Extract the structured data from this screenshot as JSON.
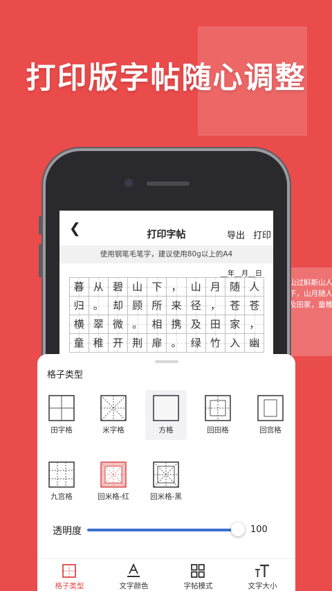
{
  "headline": "打印版字帖随心调整",
  "side_text": [
    "山过斛斯山人",
    "下，山月随人",
    "及田家，童稚"
  ],
  "app": {
    "nav": {
      "back_icon": "chevron-left-icon",
      "title": "打印字帖",
      "export_label": "导出",
      "print_label": "打印"
    },
    "notice": "使用钢笔毛笔字，建议使用80g以上的A4",
    "date_line": "__年__月__日",
    "grid_chars": [
      [
        "暮",
        "从",
        "碧",
        "山",
        "下",
        "，",
        "山",
        "月",
        "随",
        "人"
      ],
      [
        "归",
        "。",
        "却",
        "顾",
        "所",
        "来",
        "径",
        "，",
        "苍",
        "苍"
      ],
      [
        "横",
        "翠",
        "微",
        "。",
        "相",
        "携",
        "及",
        "田",
        "家",
        "，"
      ],
      [
        "",
        "童",
        "稚",
        "开",
        "荆",
        "扉",
        "。",
        "绿",
        "竹",
        "入",
        "幽"
      ]
    ]
  },
  "panel": {
    "title": "格子类型",
    "options": [
      {
        "label": "田字格",
        "icon": "tian-grid-icon",
        "selected": false
      },
      {
        "label": "米字格",
        "icon": "mi-grid-icon",
        "selected": false
      },
      {
        "label": "方格",
        "icon": "square-grid-icon",
        "selected": true
      },
      {
        "label": "回田格",
        "icon": "hui-tian-grid-icon",
        "selected": false
      },
      {
        "label": "回宫格",
        "icon": "hui-gong-grid-icon",
        "selected": false
      },
      {
        "label": "九宫格",
        "icon": "nine-grid-icon",
        "selected": false
      },
      {
        "label": "回米格-红",
        "icon": "hui-mi-red-grid-icon",
        "selected": false
      },
      {
        "label": "回米格-黑",
        "icon": "hui-mi-black-grid-icon",
        "selected": false
      }
    ],
    "transparency": {
      "label": "透明度",
      "value": "100",
      "fraction": 1.0
    },
    "tabs": [
      {
        "label": "格子类型",
        "icon": "grid-type-icon",
        "active": true
      },
      {
        "label": "文字颜色",
        "icon": "text-color-icon",
        "active": false
      },
      {
        "label": "字帖模式",
        "icon": "layout-mode-icon",
        "active": false
      },
      {
        "label": "文字大小",
        "icon": "text-size-icon",
        "active": false
      }
    ]
  },
  "colors": {
    "background": "#ea4b4b",
    "accent_blue": "#3b6fd0",
    "active_tab": "#e04848"
  }
}
